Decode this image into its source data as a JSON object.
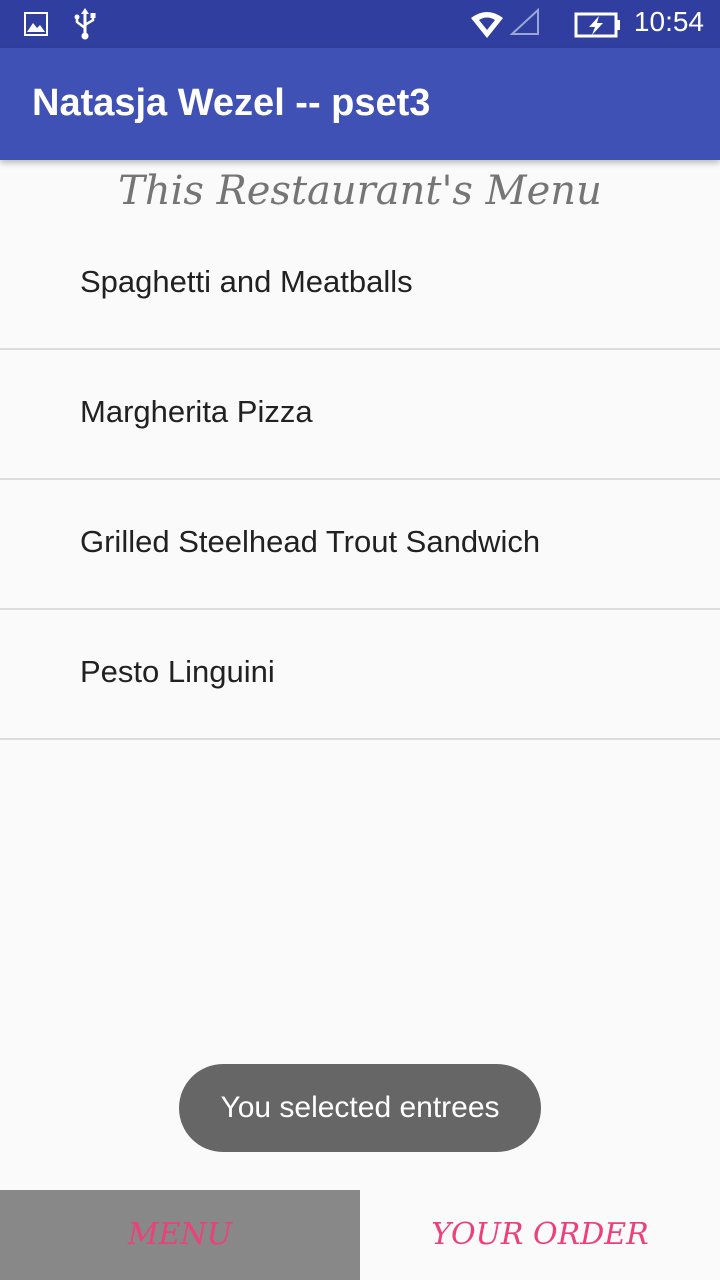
{
  "status_bar": {
    "time": "10:54",
    "icons": [
      "image-icon",
      "usb-icon",
      "wifi-icon",
      "cell-signal-icon",
      "battery-charging-icon"
    ]
  },
  "app_bar": {
    "title": "Natasja Wezel -- pset3"
  },
  "menu": {
    "heading": "This Restaurant's Menu",
    "items": [
      {
        "label": "Spaghetti and Meatballs"
      },
      {
        "label": "Margherita Pizza"
      },
      {
        "label": "Grilled Steelhead Trout Sandwich"
      },
      {
        "label": "Pesto Linguini"
      }
    ]
  },
  "toast": {
    "message": "You selected entrees"
  },
  "bottom_tabs": {
    "menu_label": "MENU",
    "order_label": "YOUR ORDER"
  },
  "colors": {
    "status_bar": "#303f9f",
    "app_bar": "#3f51b5",
    "tab_text": "#ec407a",
    "selected_tab_bg": "#888888"
  }
}
